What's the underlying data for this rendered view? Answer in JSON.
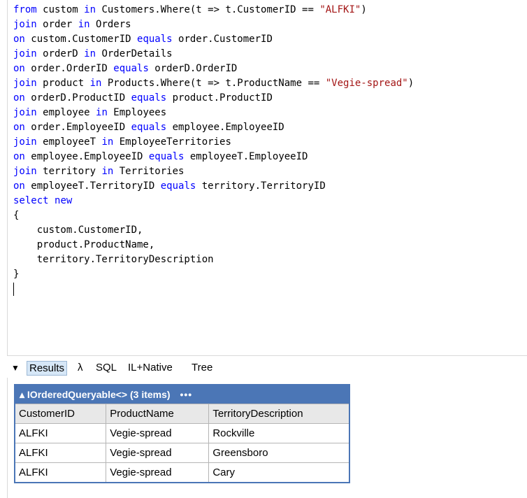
{
  "code": {
    "lines": [
      [
        {
          "t": "from",
          "k": 1
        },
        {
          "t": " custom "
        },
        {
          "t": "in",
          "k": 1
        },
        {
          "t": " Customers.Where(t => t.CustomerID == "
        },
        {
          "t": "\"ALFKI\"",
          "s": 1
        },
        {
          "t": ")"
        }
      ],
      [
        {
          "t": "join",
          "k": 1
        },
        {
          "t": " order "
        },
        {
          "t": "in",
          "k": 1
        },
        {
          "t": " Orders"
        }
      ],
      [
        {
          "t": "on",
          "k": 1
        },
        {
          "t": " custom.CustomerID "
        },
        {
          "t": "equals",
          "k": 1
        },
        {
          "t": " order.CustomerID"
        }
      ],
      [
        {
          "t": "join",
          "k": 1
        },
        {
          "t": " orderD "
        },
        {
          "t": "in",
          "k": 1
        },
        {
          "t": " OrderDetails"
        }
      ],
      [
        {
          "t": "on",
          "k": 1
        },
        {
          "t": " order.OrderID "
        },
        {
          "t": "equals",
          "k": 1
        },
        {
          "t": " orderD.OrderID"
        }
      ],
      [
        {
          "t": "join",
          "k": 1
        },
        {
          "t": " product "
        },
        {
          "t": "in",
          "k": 1
        },
        {
          "t": " Products.Where(t => t.ProductName == "
        },
        {
          "t": "\"Vegie-spread\"",
          "s": 1
        },
        {
          "t": ")"
        }
      ],
      [
        {
          "t": "on",
          "k": 1
        },
        {
          "t": " orderD.ProductID "
        },
        {
          "t": "equals",
          "k": 1
        },
        {
          "t": " product.ProductID"
        }
      ],
      [
        {
          "t": "join",
          "k": 1
        },
        {
          "t": " employee "
        },
        {
          "t": "in",
          "k": 1
        },
        {
          "t": " Employees"
        }
      ],
      [
        {
          "t": "on",
          "k": 1
        },
        {
          "t": " order.EmployeeID "
        },
        {
          "t": "equals",
          "k": 1
        },
        {
          "t": " employee.EmployeeID"
        }
      ],
      [
        {
          "t": "join",
          "k": 1
        },
        {
          "t": " employeeT "
        },
        {
          "t": "in",
          "k": 1
        },
        {
          "t": " EmployeeTerritories"
        }
      ],
      [
        {
          "t": "on",
          "k": 1
        },
        {
          "t": " employee.EmployeeID "
        },
        {
          "t": "equals",
          "k": 1
        },
        {
          "t": " employeeT.EmployeeID"
        }
      ],
      [
        {
          "t": "join",
          "k": 1
        },
        {
          "t": " territory "
        },
        {
          "t": "in",
          "k": 1
        },
        {
          "t": " Territories"
        }
      ],
      [
        {
          "t": "on",
          "k": 1
        },
        {
          "t": " employeeT.TerritoryID "
        },
        {
          "t": "equals",
          "k": 1
        },
        {
          "t": " territory.TerritoryID"
        }
      ],
      [
        {
          "t": "select",
          "k": 1
        },
        {
          "t": " "
        },
        {
          "t": "new",
          "k": 1
        }
      ],
      [
        {
          "t": "{"
        }
      ],
      [
        {
          "t": "    custom.CustomerID,"
        }
      ],
      [
        {
          "t": "    product.ProductName,"
        }
      ],
      [
        {
          "t": "    territory.TerritoryDescription"
        }
      ],
      [
        {
          "t": "}"
        }
      ]
    ]
  },
  "tabs": {
    "results": "Results",
    "lambda": "λ",
    "sql": "SQL",
    "il_native": "IL+Native",
    "tree": "Tree"
  },
  "grid": {
    "header_title": "▴ IOrderedQueryable<> (3 items)",
    "header_more": "•••",
    "columns": [
      "CustomerID",
      "ProductName",
      "TerritoryDescription"
    ],
    "rows": [
      [
        "ALFKI",
        "Vegie-spread",
        "Rockville"
      ],
      [
        "ALFKI",
        "Vegie-spread",
        "Greensboro"
      ],
      [
        "ALFKI",
        "Vegie-spread",
        "Cary"
      ]
    ]
  }
}
